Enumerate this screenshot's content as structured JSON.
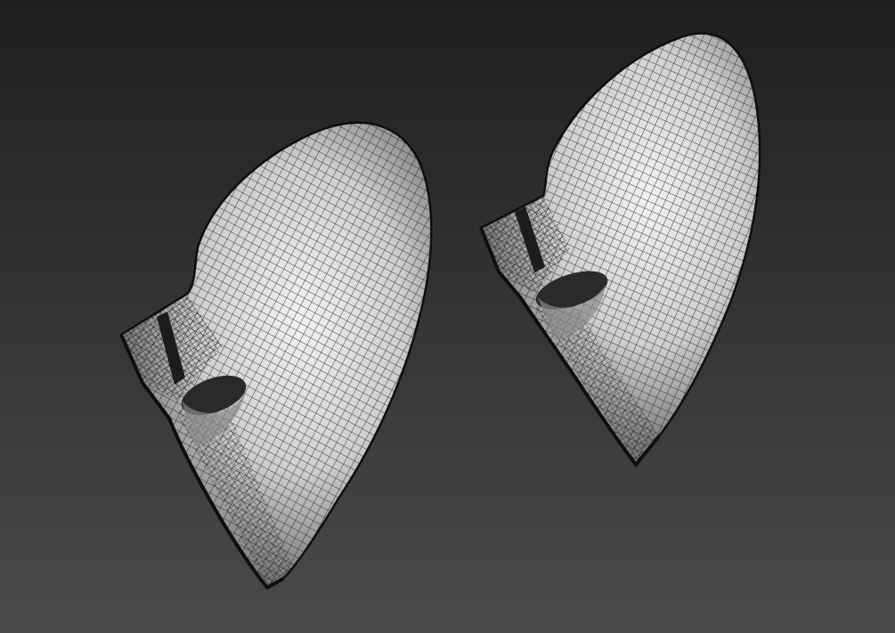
{
  "scene": {
    "background_top": "#1f1f1f",
    "background_bottom": "#4a4a4a",
    "mesh_fill_light": "#f2f2f2",
    "mesh_fill_mid": "#bdbdbd",
    "mesh_fill_dark": "#6e6e6e",
    "wire_color": "#1a1a1a",
    "objects": [
      {
        "name": "left-mesh-part"
      },
      {
        "name": "right-mesh-part"
      }
    ]
  }
}
